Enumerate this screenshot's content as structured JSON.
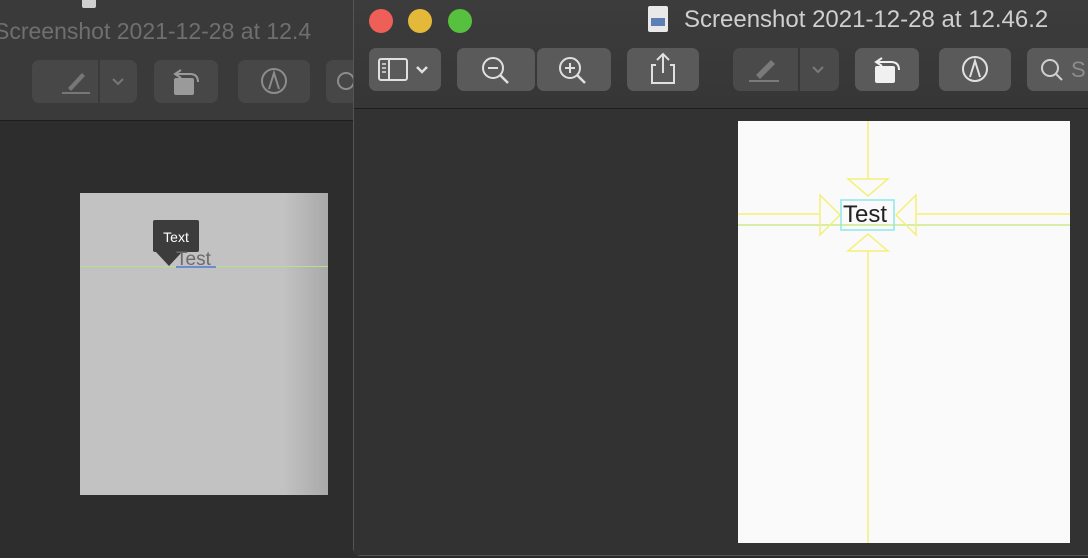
{
  "back_window": {
    "title": "Screenshot 2021-12-28 at 12.4",
    "page": {
      "tooltip_label": "Text",
      "text_item": "Test"
    }
  },
  "front_window": {
    "title": "Screenshot 2021-12-28 at 12.46.2",
    "traffic_lights": {
      "close": "#ee5f58",
      "minimize": "#e4b93a",
      "zoom": "#58c03f"
    },
    "toolbar": {
      "sidebar_toggle": "sidebar-icon",
      "zoom_out": "zoom-out-icon",
      "zoom_in": "zoom-in-icon",
      "share": "share-icon",
      "markup": "markup-pen-icon",
      "rotate": "rotate-left-icon",
      "annotate": "annotate-pen-icon",
      "search_placeholder": "S"
    },
    "page": {
      "text_item": "Test"
    }
  },
  "colors": {
    "guide_yellow": "#f5f07a",
    "guide_green": "#b8e08a",
    "selection_cyan": "#8fe7ea"
  }
}
